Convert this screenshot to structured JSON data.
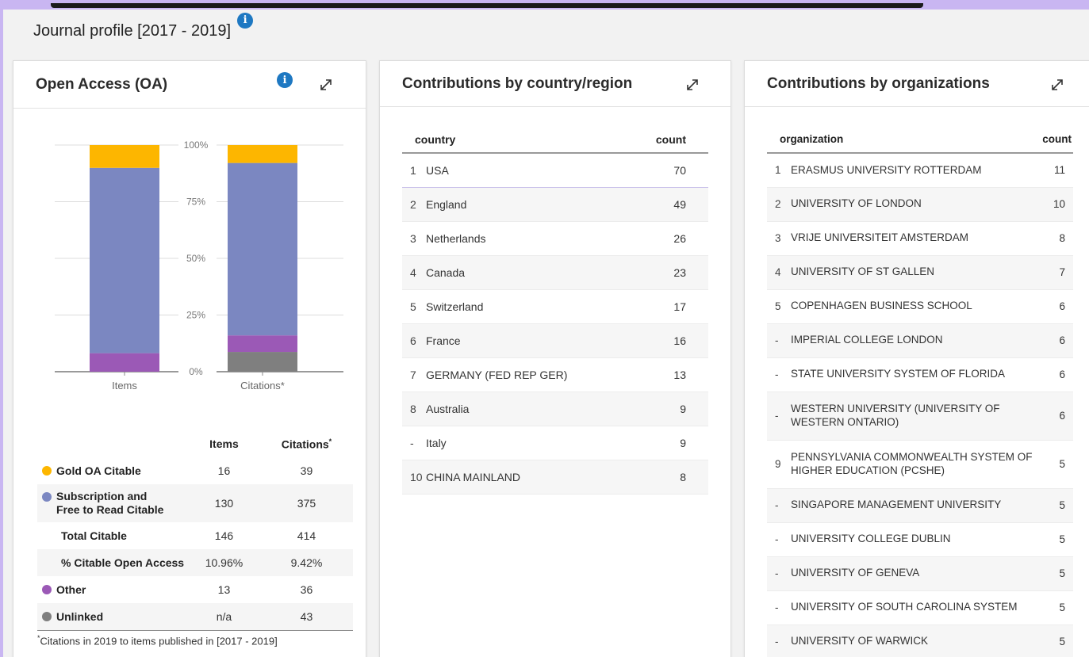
{
  "page": {
    "title": "Journal profile [2017 - 2019]",
    "info_icon": "info-icon"
  },
  "oa_panel": {
    "title": "Open Access (OA)",
    "icons": [
      "info-icon",
      "expand-icon"
    ],
    "colors": {
      "gold": "#fdb600",
      "subscription": "#7b87c1",
      "other": "#9b59b6",
      "unlinked": "#7f7f7f"
    },
    "table": {
      "headers": [
        "Items",
        "Citations"
      ],
      "header_footnote_mark": "*",
      "rows": [
        {
          "label": "Gold OA Citable",
          "dot": "gold",
          "items": "16",
          "citations": "39"
        },
        {
          "label": "Subscription and Free to Read Citable",
          "dot": "subscription",
          "items": "130",
          "citations": "375"
        },
        {
          "label": "Total Citable",
          "dot": null,
          "items": "146",
          "citations": "414"
        },
        {
          "label": "% Citable Open Access",
          "dot": null,
          "items": "10.96%",
          "citations": "9.42%"
        },
        {
          "label": "Other",
          "dot": "other",
          "items": "13",
          "citations": "36"
        },
        {
          "label": "Unlinked",
          "dot": "unlinked",
          "items": "n/a",
          "citations": "43"
        }
      ]
    },
    "footnote_mark": "*",
    "footnote": "Citations in 2019 to items published in [2017 - 2019]"
  },
  "chart_data": {
    "type": "bar",
    "stacked": true,
    "percent_stacked": true,
    "categories": [
      "Items",
      "Citations"
    ],
    "category_marks": [
      "",
      "*"
    ],
    "yticks": [
      "100%",
      "75%",
      "50%",
      "25%",
      "0%"
    ],
    "ylim": [
      0,
      100
    ],
    "grid": true,
    "series": [
      {
        "key": "unlinked",
        "values": [
          0,
          43
        ],
        "color": "#7f7f7f"
      },
      {
        "key": "other",
        "values": [
          13,
          36
        ],
        "color": "#9b59b6"
      },
      {
        "key": "subscription",
        "values": [
          130,
          375
        ],
        "color": "#7b87c1"
      },
      {
        "key": "gold",
        "values": [
          16,
          39
        ],
        "color": "#fdb600"
      }
    ]
  },
  "country_panel": {
    "title": "Contributions by country/region",
    "icon": "expand-icon",
    "headers": {
      "name": "country",
      "count": "count"
    },
    "rows": [
      {
        "rank": "1",
        "name": "USA",
        "count": "70"
      },
      {
        "rank": "2",
        "name": "England",
        "count": "49"
      },
      {
        "rank": "3",
        "name": "Netherlands",
        "count": "26"
      },
      {
        "rank": "4",
        "name": "Canada",
        "count": "23"
      },
      {
        "rank": "5",
        "name": "Switzerland",
        "count": "17"
      },
      {
        "rank": "6",
        "name": "France",
        "count": "16"
      },
      {
        "rank": "7",
        "name": "GERMANY (FED REP GER)",
        "count": "13"
      },
      {
        "rank": "8",
        "name": "Australia",
        "count": "9"
      },
      {
        "rank": "-",
        "name": "Italy",
        "count": "9"
      },
      {
        "rank": "10",
        "name": "CHINA MAINLAND",
        "count": "8"
      }
    ]
  },
  "org_panel": {
    "title": "Contributions by organizations",
    "icon": "expand-icon",
    "headers": {
      "name": "organization",
      "count": "count"
    },
    "rows": [
      {
        "rank": "1",
        "name": "ERASMUS UNIVERSITY ROTTERDAM",
        "count": "11"
      },
      {
        "rank": "2",
        "name": "UNIVERSITY OF LONDON",
        "count": "10"
      },
      {
        "rank": "3",
        "name": "VRIJE UNIVERSITEIT AMSTERDAM",
        "count": "8"
      },
      {
        "rank": "4",
        "name": "UNIVERSITY OF ST GALLEN",
        "count": "7"
      },
      {
        "rank": "5",
        "name": "COPENHAGEN BUSINESS SCHOOL",
        "count": "6"
      },
      {
        "rank": "-",
        "name": "IMPERIAL COLLEGE LONDON",
        "count": "6"
      },
      {
        "rank": "-",
        "name": "STATE UNIVERSITY SYSTEM OF FLORIDA",
        "count": "6"
      },
      {
        "rank": "-",
        "name": "WESTERN UNIVERSITY (UNIVERSITY OF WESTERN ONTARIO)",
        "count": "6"
      },
      {
        "rank": "9",
        "name": "PENNSYLVANIA COMMONWEALTH SYSTEM OF HIGHER EDUCATION (PCSHE)",
        "count": "5"
      },
      {
        "rank": "-",
        "name": "SINGAPORE MANAGEMENT UNIVERSITY",
        "count": "5"
      },
      {
        "rank": "-",
        "name": "UNIVERSITY COLLEGE DUBLIN",
        "count": "5"
      },
      {
        "rank": "-",
        "name": "UNIVERSITY OF GENEVA",
        "count": "5"
      },
      {
        "rank": "-",
        "name": "UNIVERSITY OF SOUTH CAROLINA SYSTEM",
        "count": "5"
      },
      {
        "rank": "-",
        "name": "UNIVERSITY OF WARWICK",
        "count": "5"
      }
    ]
  }
}
